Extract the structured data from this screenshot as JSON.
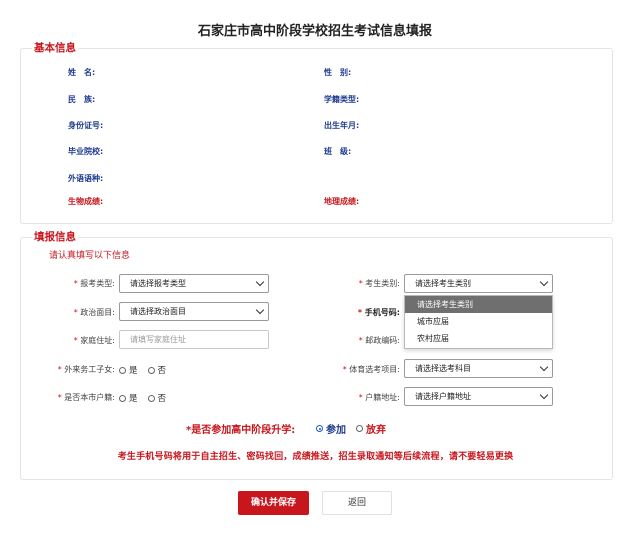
{
  "page_title": "石家庄市高中阶段学校招生考试信息填报",
  "basic_info": {
    "section_title": "基本信息",
    "fields": {
      "name": "姓　名:",
      "gender": "性　别:",
      "ethnicity": "民　族:",
      "student_status": "学籍类型:",
      "id_number": "身份证号:",
      "birth": "出生年月:",
      "school": "毕业院校:",
      "class": "班　级:",
      "foreign_language": "外语语种:",
      "biology": "生物成绩:",
      "geography": "地理成绩:"
    }
  },
  "fill_info": {
    "section_title": "填报信息",
    "hint": "请认真填写以下信息",
    "exam_type": {
      "label": "报考类型:",
      "value": "请选择报考类型"
    },
    "candidate_category": {
      "label": "考生类别:",
      "value": "请选择考生类别",
      "options": [
        "请选择考生类别",
        "城市应届",
        "农村应届"
      ]
    },
    "political_status": {
      "label": "政治面目:",
      "value": "请选择政治面目"
    },
    "phone": {
      "label": "手机号码:"
    },
    "home_address": {
      "label": "家庭住址:",
      "placeholder": "请填写家庭住址"
    },
    "postal_code": {
      "label": "邮政编码:"
    },
    "migrant_child": {
      "label": "外来务工子女:",
      "yes": "是",
      "no": "否"
    },
    "pe_item": {
      "label": "体育选考项目:",
      "value": "请选择选考科目"
    },
    "local_hukou": {
      "label": "是否本市户籍:",
      "yes": "是",
      "no": "否"
    },
    "hukou_address": {
      "label": "户籍地址:",
      "value": "请选择户籍地址"
    },
    "star": "*",
    "question": "*是否参加高中阶段升学:",
    "join": "参加",
    "abandon": "放弃",
    "notice": "考生手机号码将用于自主招生、密码找回，成绩推送，招生录取通知等后续流程，请不要轻易更换"
  },
  "buttons": {
    "confirm": "确认并保存",
    "back": "返回"
  },
  "colors": {
    "accent_red": "#c8161d",
    "label_blue": "#1f3b8f"
  }
}
